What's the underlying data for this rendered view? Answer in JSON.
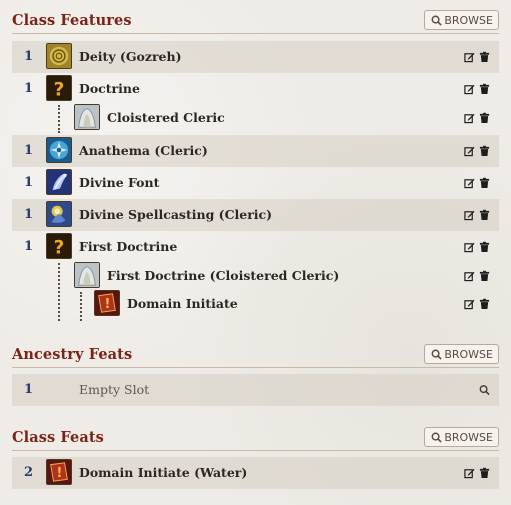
{
  "sections": {
    "class_features": {
      "title": "Class Features",
      "browse_label": "BROWSE"
    },
    "ancestry_feats": {
      "title": "Ancestry Feats",
      "browse_label": "BROWSE"
    },
    "class_feats": {
      "title": "Class Feats",
      "browse_label": "BROWSE"
    }
  },
  "class_features": [
    {
      "level": "1",
      "name": "Deity (Gozreh)",
      "icon": "deity-icon"
    },
    {
      "level": "1",
      "name": "Doctrine",
      "icon": "question-icon"
    },
    {
      "level": "",
      "name": "Cloistered Cleric",
      "icon": "cloistered-cleric-icon"
    },
    {
      "level": "1",
      "name": "Anathema (Cleric)",
      "icon": "anathema-icon"
    },
    {
      "level": "1",
      "name": "Divine Font",
      "icon": "divine-font-icon"
    },
    {
      "level": "1",
      "name": "Divine Spellcasting (Cleric)",
      "icon": "divine-spellcasting-icon"
    },
    {
      "level": "1",
      "name": "First Doctrine",
      "icon": "question-icon"
    },
    {
      "level": "",
      "name": "First Doctrine (Cloistered Cleric)",
      "icon": "cloistered-cleric-icon"
    },
    {
      "level": "",
      "name": "Domain Initiate",
      "icon": "domain-initiate-icon"
    }
  ],
  "ancestry_feats": [
    {
      "level": "1",
      "name": "Empty Slot",
      "icon": "search-icon"
    }
  ],
  "class_feats": [
    {
      "level": "2",
      "name": "Domain Initiate (Water)",
      "icon": "domain-initiate-icon"
    }
  ],
  "colors": {
    "section_title": "#7b2317",
    "level_number": "#2b3b6e",
    "row_shade": "#d6cec3"
  }
}
